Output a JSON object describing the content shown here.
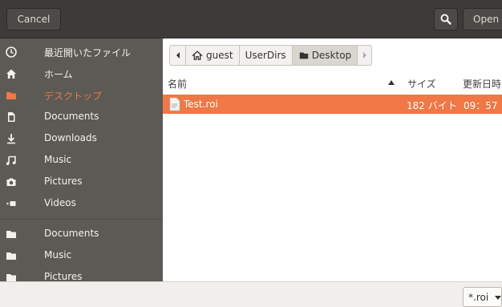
{
  "header": {
    "cancel_label": "Cancel",
    "search_icon": "search-icon",
    "open_label": "Open"
  },
  "sidebar": {
    "items": [
      {
        "label": "最近開いたファイル",
        "icon": "clock-icon"
      },
      {
        "label": "ホーム",
        "icon": "home-icon"
      },
      {
        "label": "デスクトップ",
        "icon": "folder-icon",
        "active": true
      },
      {
        "label": "Documents",
        "icon": "document-icon"
      },
      {
        "label": "Downloads",
        "icon": "download-icon"
      },
      {
        "label": "Music",
        "icon": "music-icon"
      },
      {
        "label": "Pictures",
        "icon": "camera-icon"
      },
      {
        "label": "Videos",
        "icon": "video-icon"
      },
      {
        "label": "Documents",
        "icon": "folder-icon"
      },
      {
        "label": "Music",
        "icon": "folder-icon"
      },
      {
        "label": "Pictures",
        "icon": "folder-icon"
      }
    ]
  },
  "pathbar": {
    "segments": [
      "guest",
      "UserDirs",
      "Desktop"
    ]
  },
  "columns": {
    "name": "名前",
    "size": "サイズ",
    "modified": "更新日時"
  },
  "files": [
    {
      "name": "Test.roi",
      "size": "182 バイト",
      "modified": "09：57",
      "icon": "file-icon"
    }
  ],
  "footer": {
    "filter_value": "*.roi"
  },
  "colors": {
    "accent": "#f07746",
    "sidebar_bg": "#5b5a55",
    "header_bg": "#3c3b37"
  }
}
